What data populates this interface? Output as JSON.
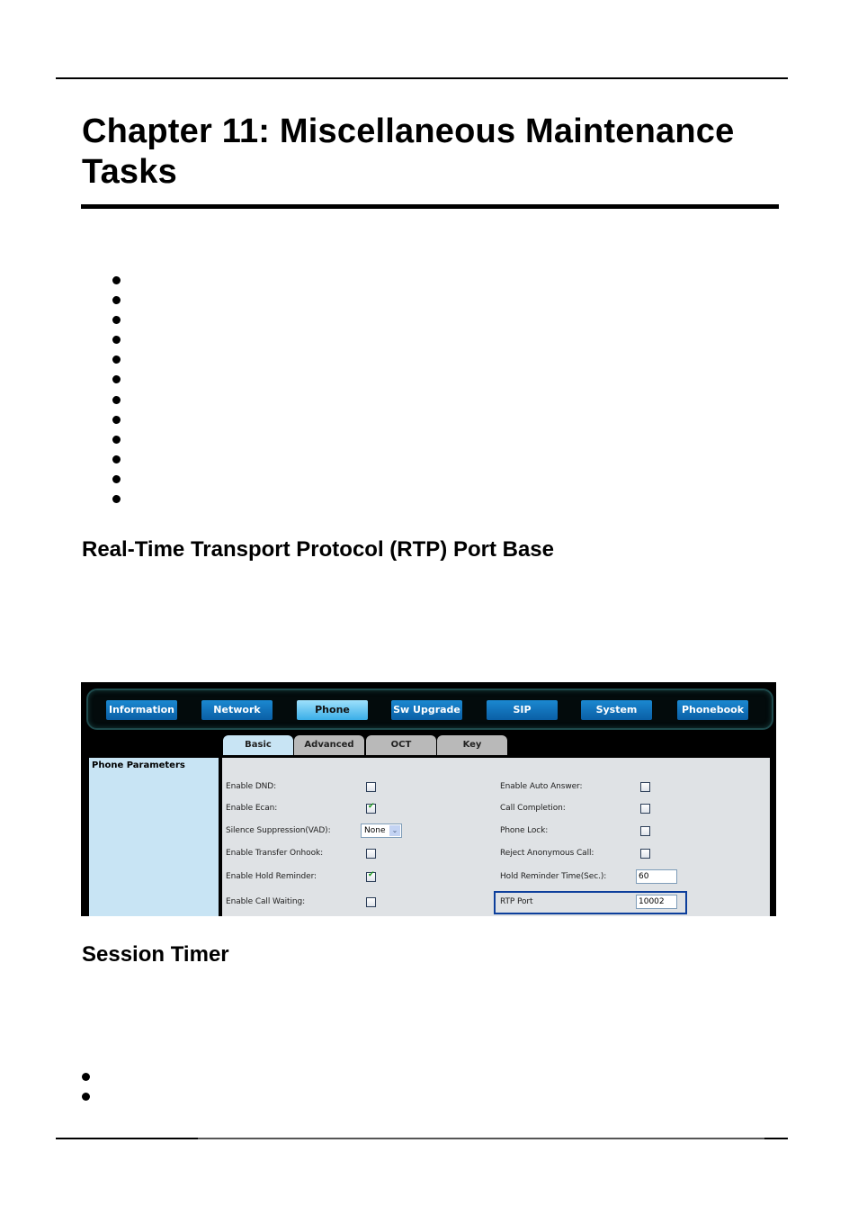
{
  "document": {
    "chapter_title": "Chapter 11: Miscellaneous Maintenance Tasks",
    "intro_bullets_count": 12,
    "section_rtp_heading": "Real-Time Transport Protocol (RTP) Port Base",
    "section_session_heading": "Session Timer",
    "session_bullets_count": 2
  },
  "screenshot": {
    "nav": [
      {
        "label": "Information",
        "active": false
      },
      {
        "label": "Network",
        "active": false
      },
      {
        "label": "Phone",
        "active": true
      },
      {
        "label": "Sw Upgrade",
        "active": false
      },
      {
        "label": "SIP",
        "active": false
      },
      {
        "label": "System",
        "active": false
      },
      {
        "label": "Phonebook",
        "active": false
      }
    ],
    "tabs": [
      {
        "label": "Basic",
        "active": true
      },
      {
        "label": "Advanced",
        "active": false
      },
      {
        "label": "OCT",
        "active": false
      },
      {
        "label": "Key",
        "active": false
      }
    ],
    "side_title": "Phone Parameters",
    "left_fields": [
      {
        "label": "Enable DND:",
        "type": "checkbox",
        "checked": false
      },
      {
        "label": "Enable Ecan:",
        "type": "checkbox",
        "checked": true
      },
      {
        "label": "Silence Suppression(VAD):",
        "type": "select",
        "value": "None"
      },
      {
        "label": "Enable Transfer Onhook:",
        "type": "checkbox",
        "checked": false
      },
      {
        "label": "Enable Hold Reminder:",
        "type": "checkbox",
        "checked": true
      },
      {
        "label": "Enable Call Waiting:",
        "type": "checkbox",
        "checked": false
      }
    ],
    "right_fields": [
      {
        "label": "Enable Auto Answer:",
        "type": "checkbox",
        "checked": false
      },
      {
        "label": "Call Completion:",
        "type": "checkbox",
        "checked": false
      },
      {
        "label": "Phone Lock:",
        "type": "checkbox",
        "checked": false
      },
      {
        "label": "Reject Anonymous Call:",
        "type": "checkbox",
        "checked": false
      },
      {
        "label": "Hold Reminder Time(Sec.):",
        "type": "text",
        "value": "60"
      },
      {
        "label": "RTP Port",
        "type": "text",
        "value": "10002",
        "highlighted": true
      }
    ],
    "colors": {
      "nav_button": "#0a6fc0",
      "nav_active": "#5cc2f2",
      "highlight_border": "#0d3f9c",
      "side_panel": "#c8e4f4",
      "check_mark": "#1b9a1b"
    }
  }
}
